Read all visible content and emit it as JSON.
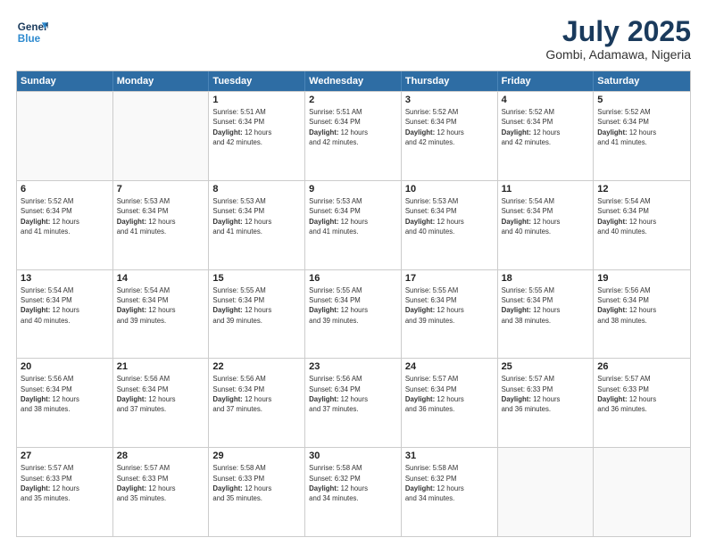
{
  "header": {
    "logo_line1": "General",
    "logo_line2": "Blue",
    "month": "July 2025",
    "location": "Gombi, Adamawa, Nigeria"
  },
  "weekdays": [
    "Sunday",
    "Monday",
    "Tuesday",
    "Wednesday",
    "Thursday",
    "Friday",
    "Saturday"
  ],
  "weeks": [
    [
      {
        "day": "",
        "sunrise": "",
        "sunset": "",
        "daylight": "",
        "empty": true
      },
      {
        "day": "",
        "sunrise": "",
        "sunset": "",
        "daylight": "",
        "empty": true
      },
      {
        "day": "1",
        "sunrise": "Sunrise: 5:51 AM",
        "sunset": "Sunset: 6:34 PM",
        "daylight": "Daylight: 12 hours and 42 minutes."
      },
      {
        "day": "2",
        "sunrise": "Sunrise: 5:51 AM",
        "sunset": "Sunset: 6:34 PM",
        "daylight": "Daylight: 12 hours and 42 minutes."
      },
      {
        "day": "3",
        "sunrise": "Sunrise: 5:52 AM",
        "sunset": "Sunset: 6:34 PM",
        "daylight": "Daylight: 12 hours and 42 minutes."
      },
      {
        "day": "4",
        "sunrise": "Sunrise: 5:52 AM",
        "sunset": "Sunset: 6:34 PM",
        "daylight": "Daylight: 12 hours and 42 minutes."
      },
      {
        "day": "5",
        "sunrise": "Sunrise: 5:52 AM",
        "sunset": "Sunset: 6:34 PM",
        "daylight": "Daylight: 12 hours and 41 minutes."
      }
    ],
    [
      {
        "day": "6",
        "sunrise": "Sunrise: 5:52 AM",
        "sunset": "Sunset: 6:34 PM",
        "daylight": "Daylight: 12 hours and 41 minutes."
      },
      {
        "day": "7",
        "sunrise": "Sunrise: 5:53 AM",
        "sunset": "Sunset: 6:34 PM",
        "daylight": "Daylight: 12 hours and 41 minutes."
      },
      {
        "day": "8",
        "sunrise": "Sunrise: 5:53 AM",
        "sunset": "Sunset: 6:34 PM",
        "daylight": "Daylight: 12 hours and 41 minutes."
      },
      {
        "day": "9",
        "sunrise": "Sunrise: 5:53 AM",
        "sunset": "Sunset: 6:34 PM",
        "daylight": "Daylight: 12 hours and 41 minutes."
      },
      {
        "day": "10",
        "sunrise": "Sunrise: 5:53 AM",
        "sunset": "Sunset: 6:34 PM",
        "daylight": "Daylight: 12 hours and 40 minutes."
      },
      {
        "day": "11",
        "sunrise": "Sunrise: 5:54 AM",
        "sunset": "Sunset: 6:34 PM",
        "daylight": "Daylight: 12 hours and 40 minutes."
      },
      {
        "day": "12",
        "sunrise": "Sunrise: 5:54 AM",
        "sunset": "Sunset: 6:34 PM",
        "daylight": "Daylight: 12 hours and 40 minutes."
      }
    ],
    [
      {
        "day": "13",
        "sunrise": "Sunrise: 5:54 AM",
        "sunset": "Sunset: 6:34 PM",
        "daylight": "Daylight: 12 hours and 40 minutes."
      },
      {
        "day": "14",
        "sunrise": "Sunrise: 5:54 AM",
        "sunset": "Sunset: 6:34 PM",
        "daylight": "Daylight: 12 hours and 39 minutes."
      },
      {
        "day": "15",
        "sunrise": "Sunrise: 5:55 AM",
        "sunset": "Sunset: 6:34 PM",
        "daylight": "Daylight: 12 hours and 39 minutes."
      },
      {
        "day": "16",
        "sunrise": "Sunrise: 5:55 AM",
        "sunset": "Sunset: 6:34 PM",
        "daylight": "Daylight: 12 hours and 39 minutes."
      },
      {
        "day": "17",
        "sunrise": "Sunrise: 5:55 AM",
        "sunset": "Sunset: 6:34 PM",
        "daylight": "Daylight: 12 hours and 39 minutes."
      },
      {
        "day": "18",
        "sunrise": "Sunrise: 5:55 AM",
        "sunset": "Sunset: 6:34 PM",
        "daylight": "Daylight: 12 hours and 38 minutes."
      },
      {
        "day": "19",
        "sunrise": "Sunrise: 5:56 AM",
        "sunset": "Sunset: 6:34 PM",
        "daylight": "Daylight: 12 hours and 38 minutes."
      }
    ],
    [
      {
        "day": "20",
        "sunrise": "Sunrise: 5:56 AM",
        "sunset": "Sunset: 6:34 PM",
        "daylight": "Daylight: 12 hours and 38 minutes."
      },
      {
        "day": "21",
        "sunrise": "Sunrise: 5:56 AM",
        "sunset": "Sunset: 6:34 PM",
        "daylight": "Daylight: 12 hours and 37 minutes."
      },
      {
        "day": "22",
        "sunrise": "Sunrise: 5:56 AM",
        "sunset": "Sunset: 6:34 PM",
        "daylight": "Daylight: 12 hours and 37 minutes."
      },
      {
        "day": "23",
        "sunrise": "Sunrise: 5:56 AM",
        "sunset": "Sunset: 6:34 PM",
        "daylight": "Daylight: 12 hours and 37 minutes."
      },
      {
        "day": "24",
        "sunrise": "Sunrise: 5:57 AM",
        "sunset": "Sunset: 6:34 PM",
        "daylight": "Daylight: 12 hours and 36 minutes."
      },
      {
        "day": "25",
        "sunrise": "Sunrise: 5:57 AM",
        "sunset": "Sunset: 6:33 PM",
        "daylight": "Daylight: 12 hours and 36 minutes."
      },
      {
        "day": "26",
        "sunrise": "Sunrise: 5:57 AM",
        "sunset": "Sunset: 6:33 PM",
        "daylight": "Daylight: 12 hours and 36 minutes."
      }
    ],
    [
      {
        "day": "27",
        "sunrise": "Sunrise: 5:57 AM",
        "sunset": "Sunset: 6:33 PM",
        "daylight": "Daylight: 12 hours and 35 minutes."
      },
      {
        "day": "28",
        "sunrise": "Sunrise: 5:57 AM",
        "sunset": "Sunset: 6:33 PM",
        "daylight": "Daylight: 12 hours and 35 minutes."
      },
      {
        "day": "29",
        "sunrise": "Sunrise: 5:58 AM",
        "sunset": "Sunset: 6:33 PM",
        "daylight": "Daylight: 12 hours and 35 minutes."
      },
      {
        "day": "30",
        "sunrise": "Sunrise: 5:58 AM",
        "sunset": "Sunset: 6:32 PM",
        "daylight": "Daylight: 12 hours and 34 minutes."
      },
      {
        "day": "31",
        "sunrise": "Sunrise: 5:58 AM",
        "sunset": "Sunset: 6:32 PM",
        "daylight": "Daylight: 12 hours and 34 minutes."
      },
      {
        "day": "",
        "sunrise": "",
        "sunset": "",
        "daylight": "",
        "empty": true
      },
      {
        "day": "",
        "sunrise": "",
        "sunset": "",
        "daylight": "",
        "empty": true
      }
    ]
  ]
}
